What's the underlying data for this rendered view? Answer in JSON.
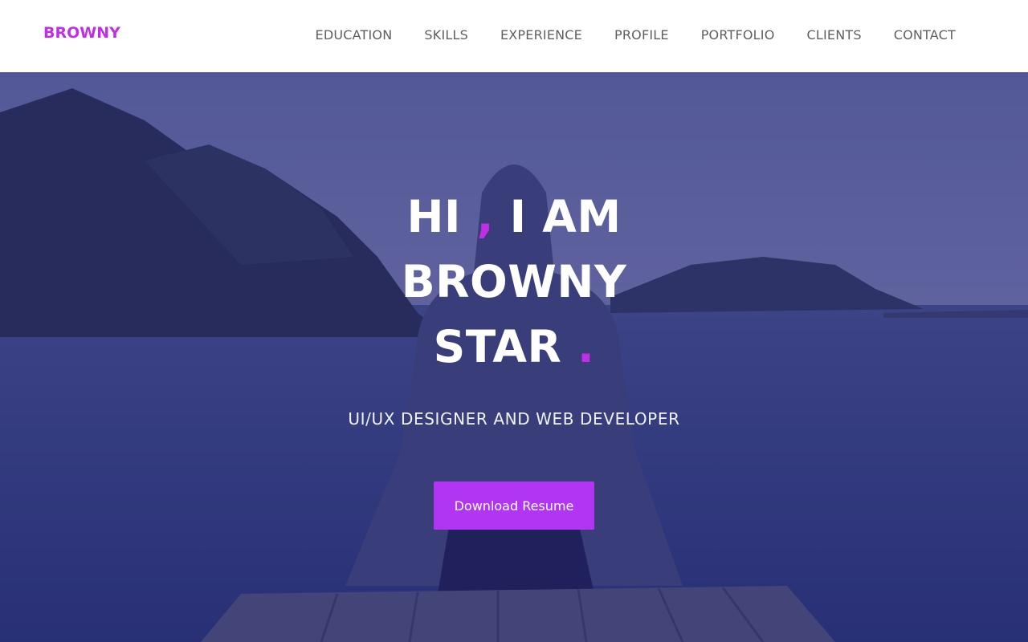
{
  "brand": {
    "name": "BROWNY"
  },
  "nav": {
    "items": [
      "EDUCATION",
      "SKILLS",
      "EXPERIENCE",
      "PROFILE",
      "PORTFOLIO",
      "CLIENTS",
      "CONTACT"
    ]
  },
  "hero": {
    "line1_a": "HI ",
    "line1_comma": ",",
    "line1_b": " I AM",
    "line2": "BROWNY",
    "line3": "STAR ",
    "line3_dot": ".",
    "subtitle": "UI/UX DESIGNER AND WEB DEVELOPER",
    "cta_label": "Download Resume"
  },
  "colors": {
    "accent": "#c02ee8",
    "button": "#b235f3",
    "overlay": "#222078",
    "nav_text": "#5f5f5f"
  }
}
